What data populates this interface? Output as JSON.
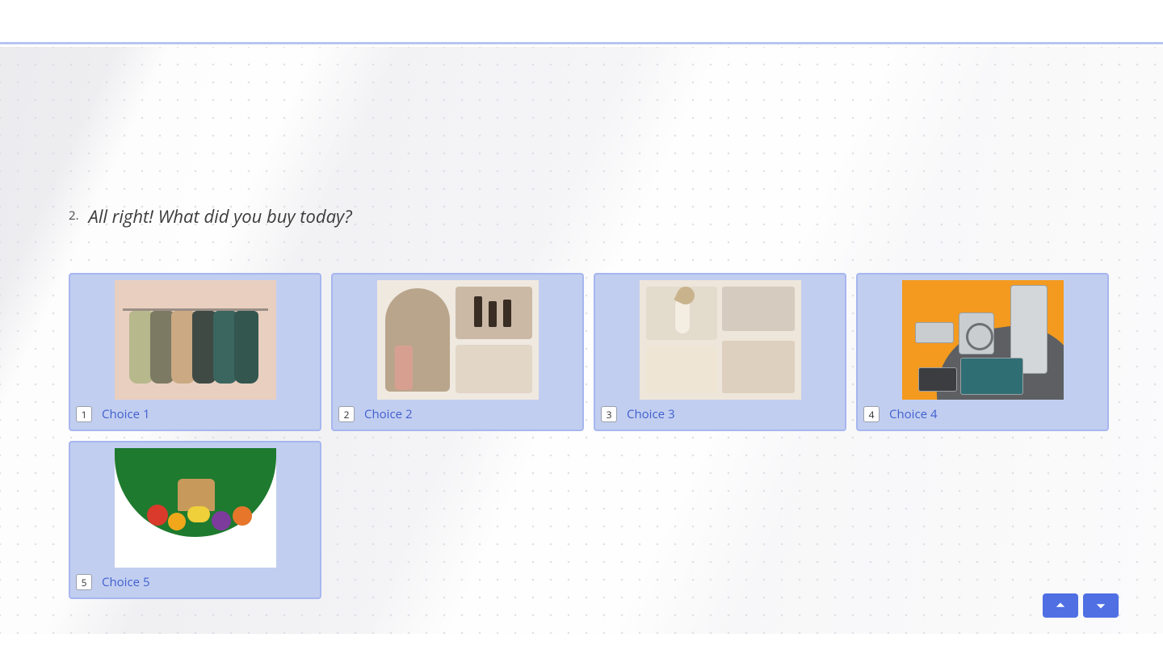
{
  "question": {
    "number": "2.",
    "text": "All right! What did you buy today?"
  },
  "choices": [
    {
      "num": "1",
      "label": "Choice 1",
      "img_kind": "clothing-rack"
    },
    {
      "num": "2",
      "label": "Choice 2",
      "img_kind": "cosmetics"
    },
    {
      "num": "3",
      "label": "Choice 3",
      "img_kind": "home-decor"
    },
    {
      "num": "4",
      "label": "Choice 4",
      "img_kind": "appliances"
    },
    {
      "num": "5",
      "label": "Choice 5",
      "img_kind": "groceries"
    }
  ],
  "colors": {
    "card_bg": "#c2cef0",
    "card_border": "#a6b6ee",
    "link": "#3f5fcf",
    "nav_btn": "#4f6fe3"
  }
}
